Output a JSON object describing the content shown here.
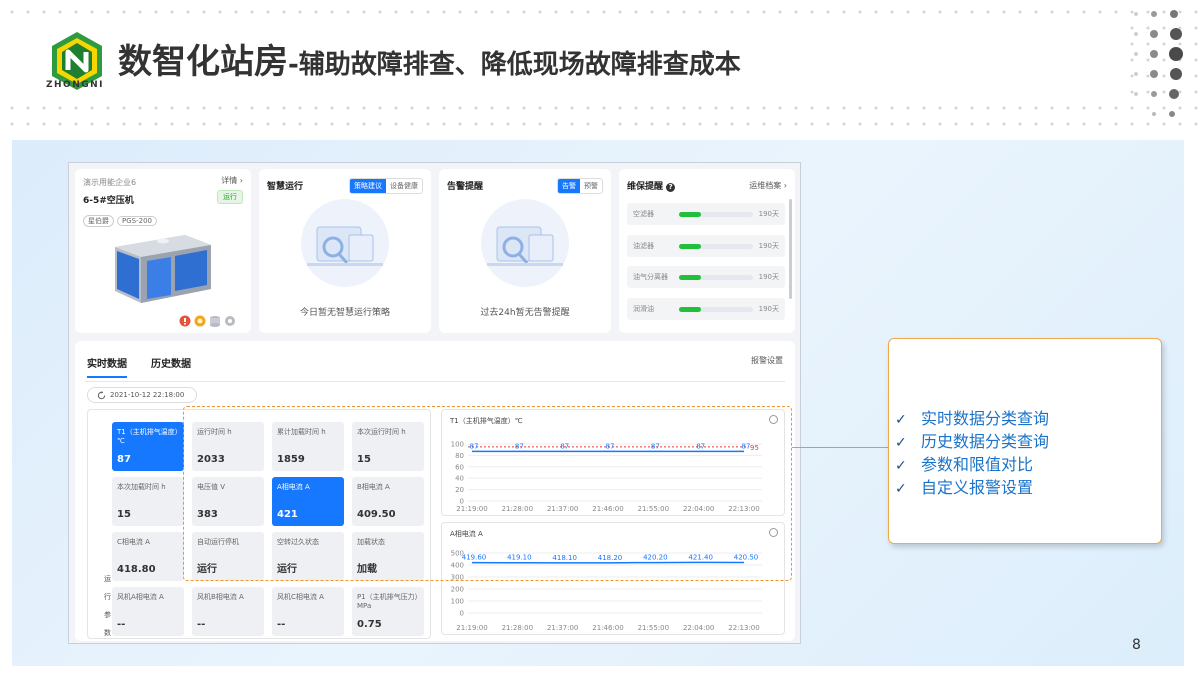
{
  "brand": {
    "logo_text": "ZHONGNI"
  },
  "title": {
    "main": "数智化站房",
    "sub": "-辅助故障排查、降低现场故障排查成本"
  },
  "device_card": {
    "company": "演示用能企业6",
    "detail_link": "详情",
    "status": "运行",
    "name": "6-5#空压机",
    "tags": [
      "星伯爵",
      "PGS-200"
    ]
  },
  "smart_card": {
    "title": "智慧运行",
    "tabs": [
      "策略建议",
      "设备健康"
    ],
    "active_tab": "策略建议",
    "empty": "今日暂无智慧运行策略"
  },
  "alarm_card": {
    "title": "告警提醒",
    "tabs": [
      "告警",
      "预警"
    ],
    "active_tab": "告警",
    "empty": "过去24h暂无告警提醒"
  },
  "maint_card": {
    "title": "维保提醒",
    "link": "运维档案",
    "items": [
      {
        "label": "空滤器",
        "days": "190天",
        "level": 0.3
      },
      {
        "label": "油滤器",
        "days": "190天",
        "level": 0.3
      },
      {
        "label": "油气分离器",
        "days": "190天",
        "level": 0.3
      },
      {
        "label": "润滑油",
        "days": "190天",
        "level": 0.3
      }
    ]
  },
  "main": {
    "tabs": [
      "实时数据",
      "历史数据"
    ],
    "active_tab": "实时数据",
    "alarm_settings": "报警设置",
    "timestamp": "2021-10-12 22:18:00",
    "side_label": [
      "运",
      "行",
      "参",
      "数"
    ],
    "cells": [
      {
        "label": "T1（主机排气温度）℃",
        "value": "87",
        "highlight": true
      },
      {
        "label": "运行时间 h",
        "value": "2033",
        "highlight": false
      },
      {
        "label": "累计加载时间 h",
        "value": "1859",
        "highlight": false
      },
      {
        "label": "本次运行时间 h",
        "value": "15",
        "highlight": false
      },
      {
        "label": "本次加载时间 h",
        "value": "15",
        "highlight": false
      },
      {
        "label": "电压值 V",
        "value": "383",
        "highlight": false
      },
      {
        "label": "A相电流 A",
        "value": "421",
        "highlight": true
      },
      {
        "label": "B相电流 A",
        "value": "409.50",
        "highlight": false
      },
      {
        "label": "C相电流 A",
        "value": "418.80",
        "highlight": false
      },
      {
        "label": "自动运行停机",
        "value": "运行",
        "highlight": false
      },
      {
        "label": "空转过久状态",
        "value": "运行",
        "highlight": false
      },
      {
        "label": "加载状态",
        "value": "加载",
        "highlight": false
      },
      {
        "label": "风机A相电流 A",
        "value": "--",
        "highlight": false
      },
      {
        "label": "风机B相电流 A",
        "value": "--",
        "highlight": false
      },
      {
        "label": "风机C相电流 A",
        "value": "--",
        "highlight": false
      },
      {
        "label": "P1（主机排气压力）MPa",
        "value": "0.75",
        "highlight": false
      }
    ]
  },
  "chart_data": [
    {
      "type": "line",
      "title": "T1（主机排气温度）℃",
      "x": [
        "21:19:00",
        "21:28:00",
        "21:37:00",
        "21:46:00",
        "21:55:00",
        "22:04:00",
        "22:13:00"
      ],
      "series": [
        {
          "values": [
            87,
            87,
            87,
            87,
            87,
            87,
            87
          ],
          "labels": [
            "87",
            "87",
            "87",
            "87",
            "87",
            "87",
            "87"
          ]
        }
      ],
      "threshold": {
        "value": 95,
        "label": "95"
      },
      "ylim": [
        0,
        100
      ],
      "yticks": [
        "100",
        "80",
        "60",
        "40",
        "20",
        "0"
      ]
    },
    {
      "type": "line",
      "title": "A相电流 A",
      "x": [
        "21:19:00",
        "21:28:00",
        "21:37:00",
        "21:46:00",
        "21:55:00",
        "22:04:00",
        "22:13:00"
      ],
      "series": [
        {
          "values": [
            419.6,
            419.1,
            418.1,
            418.2,
            420.2,
            421.4,
            420.5
          ],
          "labels": [
            "419.60",
            "419.10",
            "418.10",
            "418.20",
            "420.20",
            "421.40",
            "420.50"
          ]
        }
      ],
      "ylim": [
        0,
        500
      ],
      "yticks": [
        "500",
        "400",
        "300",
        "200",
        "100",
        "0"
      ]
    }
  ],
  "callout": {
    "items": [
      "实时数据分类查询",
      "历史数据分类查询",
      "参数和限值对比",
      "自定义报警设置"
    ]
  },
  "page_number": "8",
  "colors": {
    "accent": "#1677ff",
    "highlight_orange": "#f0952d",
    "callout_text": "#1a73c9",
    "brand_green": "#2e9b3e"
  }
}
